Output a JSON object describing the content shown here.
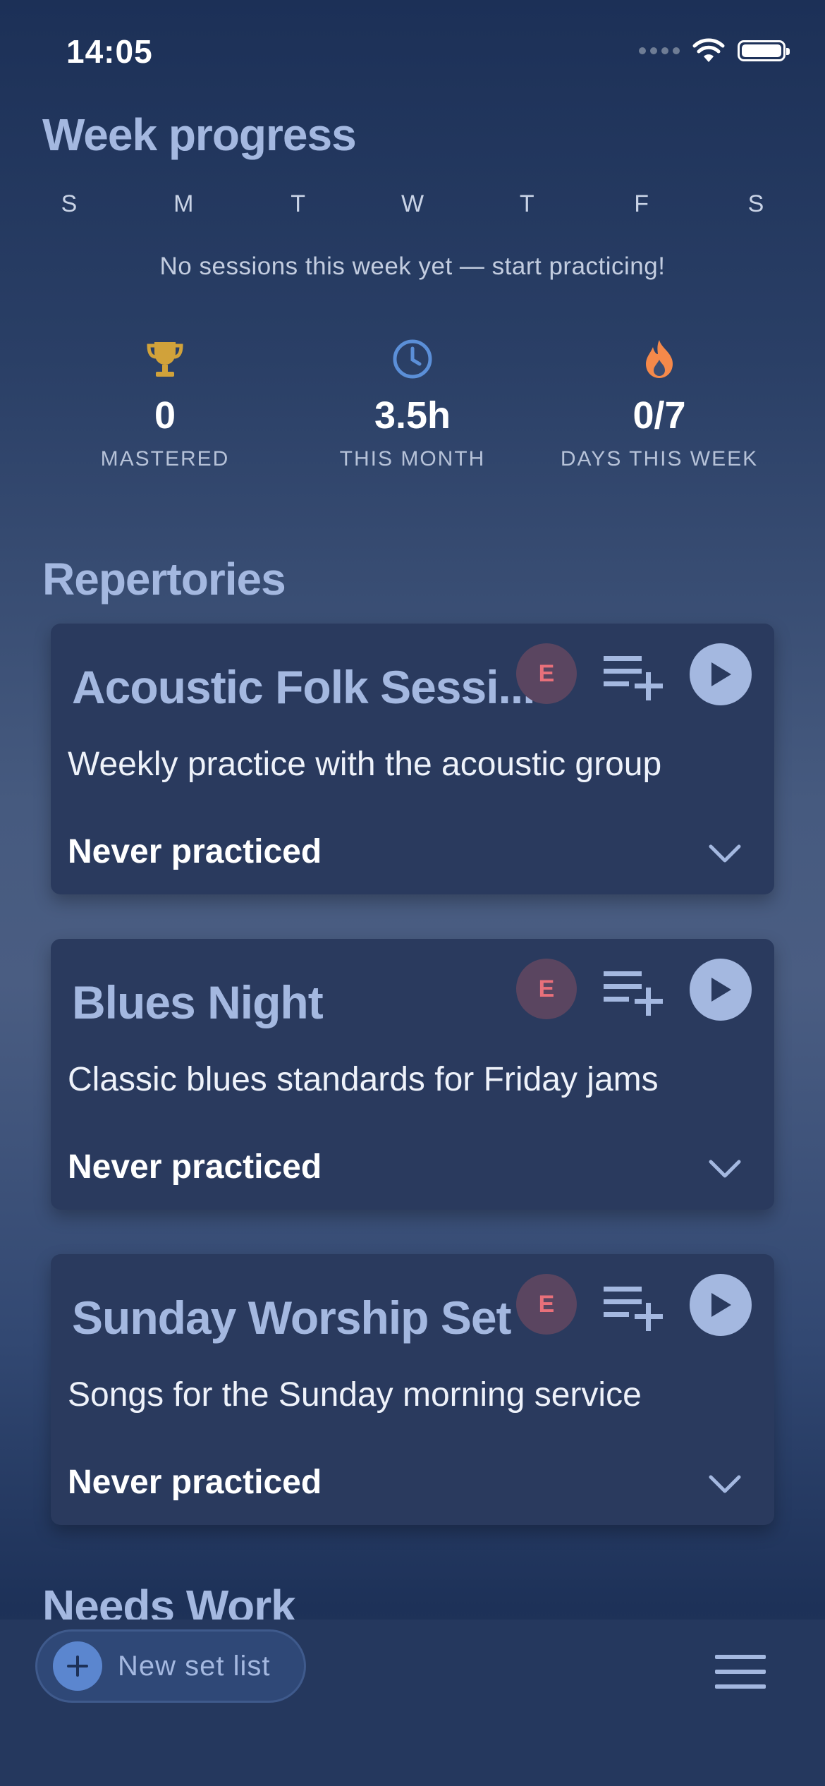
{
  "status_bar": {
    "time": "14:05"
  },
  "week_progress": {
    "title": "Week progress",
    "days": [
      "S",
      "M",
      "T",
      "W",
      "T",
      "F",
      "S"
    ],
    "message": "No sessions this week yet — start practicing!"
  },
  "stats": [
    {
      "icon": "trophy-icon",
      "value": "0",
      "label": "MASTERED",
      "color": "#d1a23a"
    },
    {
      "icon": "clock-icon",
      "value": "3.5h",
      "label": "THIS MONTH",
      "color": "#5b8fd8"
    },
    {
      "icon": "flame-icon",
      "value": "0/7",
      "label": "DAYS THIS WEEK",
      "color": "#f5894a"
    }
  ],
  "repertories": {
    "title": "Repertories",
    "items": [
      {
        "title": "Acoustic Folk Sessi...",
        "badge": "E",
        "description": "Weekly practice with the acoustic group",
        "status": "Never practiced"
      },
      {
        "title": "Blues Night",
        "badge": "E",
        "description": "Classic blues standards for Friday jams",
        "status": "Never practiced"
      },
      {
        "title": "Sunday Worship Set",
        "badge": "E",
        "description": "Songs for the Sunday morning service",
        "status": "Never practiced"
      }
    ]
  },
  "needs_work": {
    "title": "Needs Work"
  },
  "bottom_bar": {
    "new_set_list_label": "New set list"
  },
  "colors": {
    "accent": "#a4b8e0",
    "card": "#2a3a5e",
    "badge_text": "#e8707a"
  }
}
